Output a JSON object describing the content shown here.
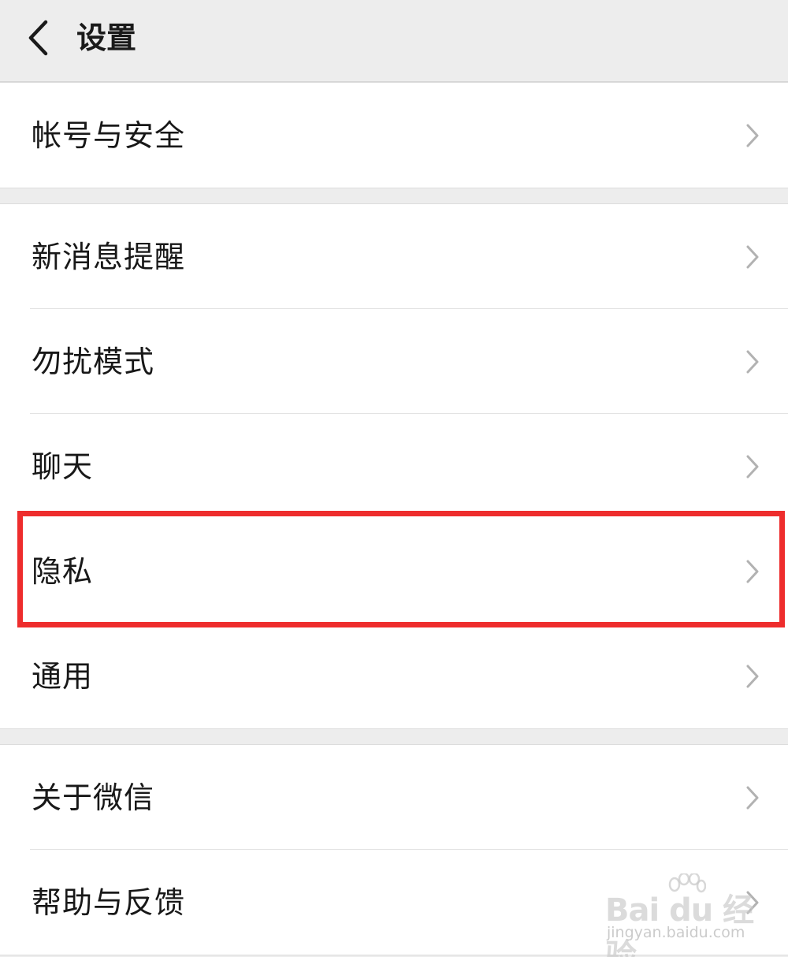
{
  "header": {
    "title": "设置",
    "back_icon": "chevron-left-icon"
  },
  "groups": [
    {
      "items": [
        {
          "label": "帐号与安全",
          "icon": "chevron-right-icon"
        }
      ]
    },
    {
      "items": [
        {
          "label": "新消息提醒",
          "icon": "chevron-right-icon"
        },
        {
          "label": "勿扰模式",
          "icon": "chevron-right-icon"
        },
        {
          "label": "聊天",
          "icon": "chevron-right-icon"
        },
        {
          "label": "隐私",
          "icon": "chevron-right-icon",
          "highlighted": true
        },
        {
          "label": "通用",
          "icon": "chevron-right-icon"
        }
      ]
    },
    {
      "items": [
        {
          "label": "关于微信",
          "icon": "chevron-right-icon"
        },
        {
          "label": "帮助与反馈",
          "icon": "chevron-right-icon"
        }
      ]
    }
  ],
  "highlight_color": "#ee2d2d",
  "watermark": {
    "brand": "Bai du 经验",
    "url": "jingyan.baidu.com"
  }
}
